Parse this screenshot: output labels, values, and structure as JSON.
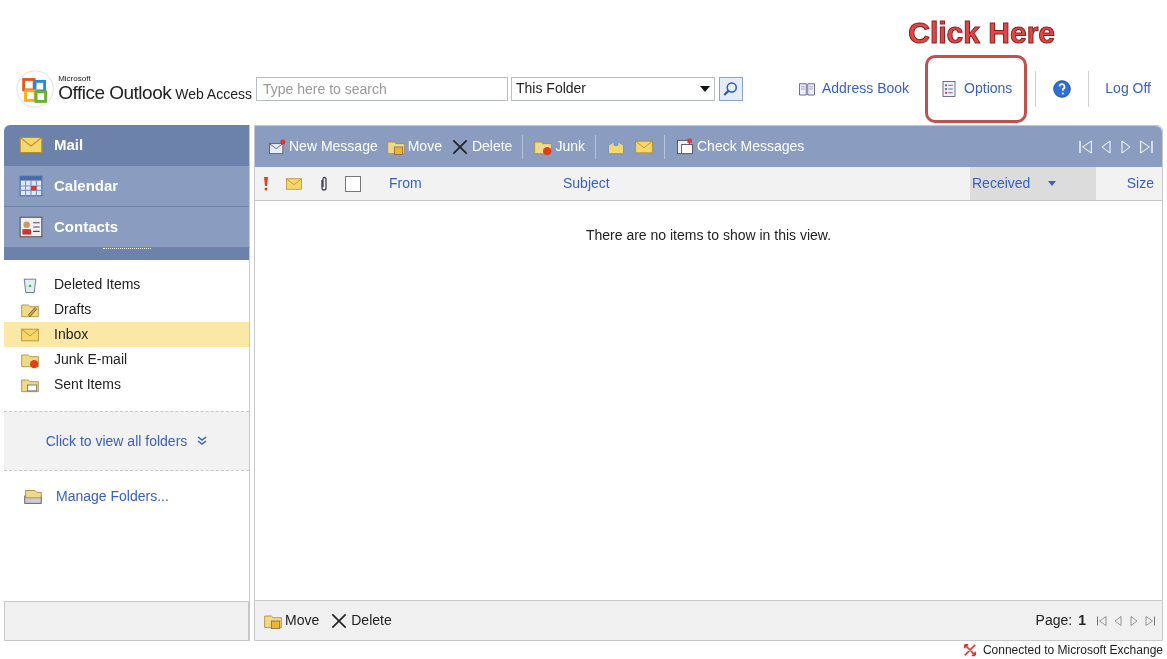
{
  "annotation": {
    "text": "Click Here"
  },
  "logo": {
    "maker": "Microsoft",
    "product": "Office Outlook",
    "edition": "Web Access"
  },
  "search": {
    "placeholder": "Type here to search",
    "scope": "This Folder"
  },
  "header_links": [
    {
      "label": "Address Book",
      "kind": "book",
      "highlighted": false
    },
    {
      "label": "Options",
      "kind": "options",
      "highlighted": true
    },
    {
      "kind": "help",
      "highlighted": false
    },
    {
      "label": "Log Off",
      "kind": "plain",
      "highlighted": false
    }
  ],
  "nav": [
    {
      "label": "Mail",
      "kind": "mail",
      "selected": true
    },
    {
      "label": "Calendar",
      "kind": "calendar",
      "selected": false
    },
    {
      "label": "Contacts",
      "kind": "contacts",
      "selected": false
    }
  ],
  "folders": [
    {
      "label": "Deleted Items",
      "kind": "trash",
      "selected": false
    },
    {
      "label": "Drafts",
      "kind": "drafts",
      "selected": false
    },
    {
      "label": "Inbox",
      "kind": "inbox",
      "selected": true
    },
    {
      "label": "Junk E-mail",
      "kind": "junk",
      "selected": false
    },
    {
      "label": "Sent Items",
      "kind": "sent",
      "selected": false
    }
  ],
  "view_all_folders": "Click to view all folders",
  "manage_folders": "Manage Folders...",
  "toolbar": [
    {
      "label": "New Message",
      "kind": "new"
    },
    {
      "label": "Move",
      "kind": "move"
    },
    {
      "label": "Delete",
      "kind": "delete"
    },
    {
      "kind": "separator"
    },
    {
      "label": "Junk",
      "kind": "junk"
    },
    {
      "kind": "separator"
    },
    {
      "kind": "reply"
    },
    {
      "kind": "envelope"
    },
    {
      "kind": "separator"
    },
    {
      "label": "Check Messages",
      "kind": "check"
    }
  ],
  "select_all": {
    "checked": false
  },
  "columns": [
    {
      "label": "From",
      "sorted": false
    },
    {
      "label": "Subject",
      "sorted": false
    },
    {
      "label": "Received",
      "sorted": true
    },
    {
      "label": "Size",
      "sorted": false
    }
  ],
  "empty_message": "There are no items to show in this view.",
  "bottom_toolbar": [
    {
      "label": "Move",
      "kind": "move"
    },
    {
      "label": "Delete",
      "kind": "delete"
    }
  ],
  "pager": {
    "label": "Page:",
    "page": "1"
  },
  "status_bar": {
    "text": "Connected to Microsoft Exchange"
  }
}
